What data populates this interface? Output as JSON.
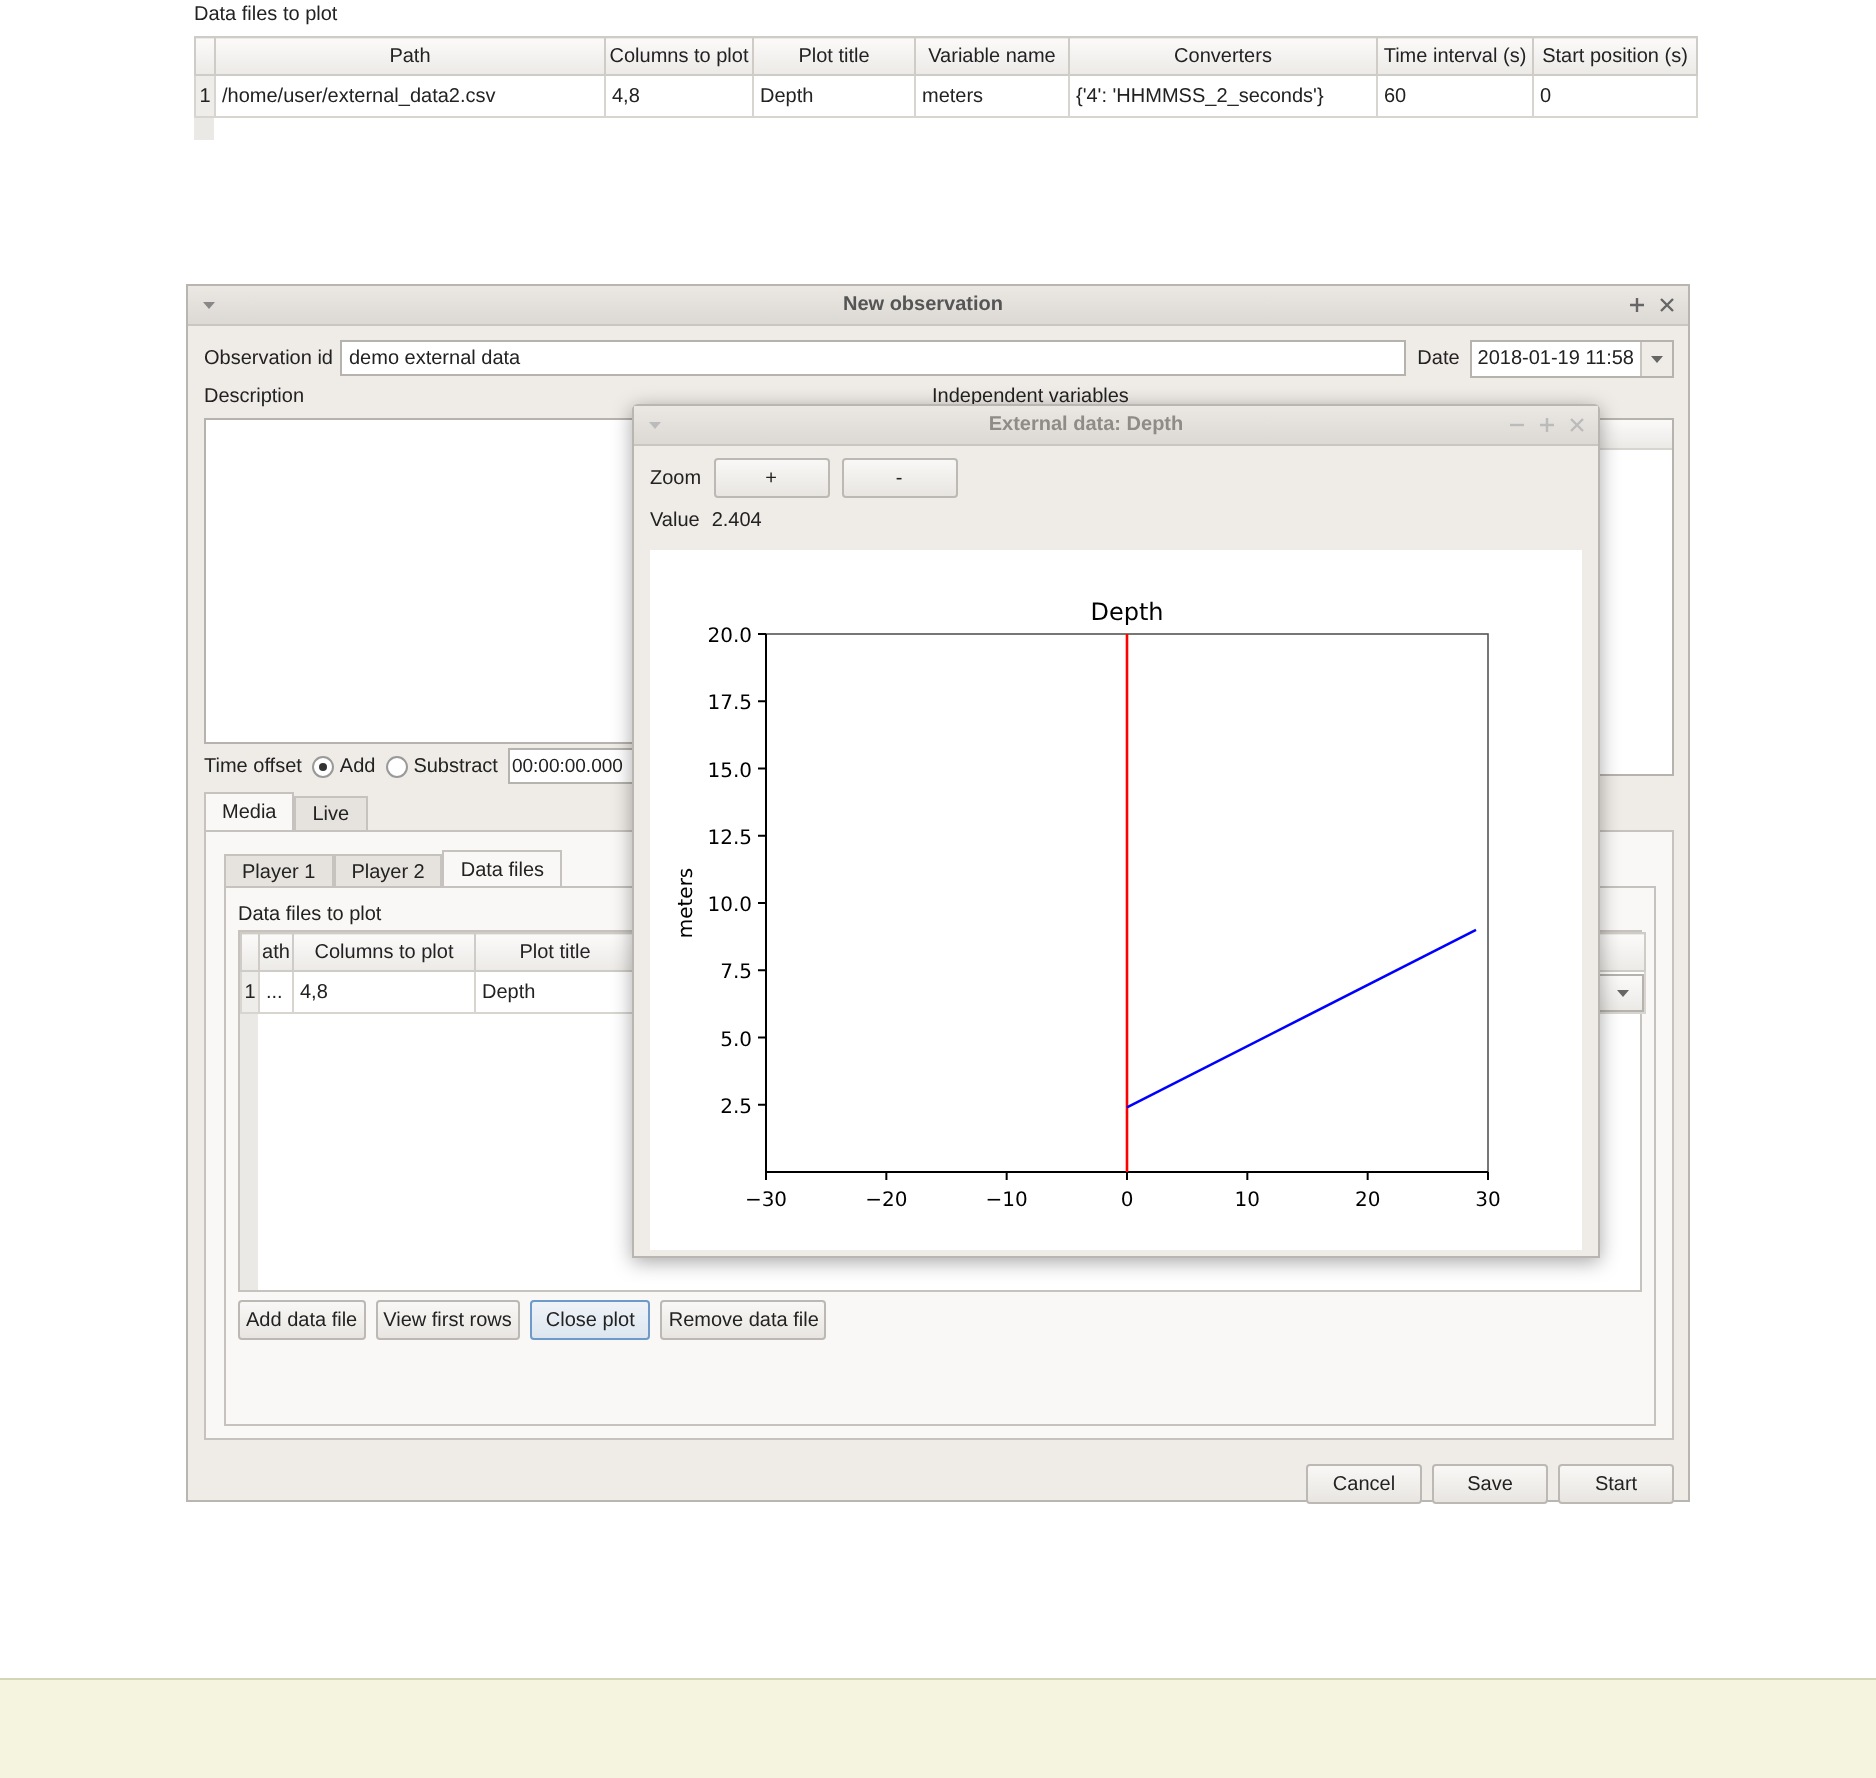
{
  "data_files_panel": {
    "label": "Data files to plot",
    "table": {
      "columns": [
        "Path",
        "Columns to plot",
        "Plot title",
        "Variable name",
        "Converters",
        "Time interval (s)",
        "Start position (s)"
      ],
      "rows": [
        {
          "number": "1",
          "cells": [
            "/home/user/external_data2.csv",
            "4,8",
            "Depth",
            "meters",
            "{'4': 'HHMMSS_2_seconds'}",
            "60",
            "0"
          ]
        }
      ]
    }
  },
  "window": {
    "title": "New observation"
  },
  "observation_id": {
    "label": "Observation id",
    "value": "demo external data"
  },
  "date": {
    "label": "Date",
    "value": "2018-01-19 11:58"
  },
  "description": {
    "label": "Description"
  },
  "independent_variables": {
    "label": "Independent variables"
  },
  "time_offset": {
    "label": "Time offset",
    "options": [
      {
        "label": "Add",
        "selected": true
      },
      {
        "label": "Substract",
        "selected": false
      }
    ],
    "value": "00:00:00.000"
  },
  "tabs": [
    {
      "label": "Media",
      "selected": true
    },
    {
      "label": "Live",
      "selected": false
    }
  ],
  "media_tabs": [
    {
      "label": "Player 1",
      "selected": false
    },
    {
      "label": "Player 2",
      "selected": false
    },
    {
      "label": "Data files",
      "selected": true
    }
  ],
  "data_files": {
    "label": "Data files to plot",
    "table": {
      "columns": [
        "ath",
        "Columns to plot",
        "Plot title"
      ],
      "rows": [
        {
          "number": "1",
          "cells": [
            "...",
            "4,8",
            "Depth"
          ]
        }
      ]
    },
    "buttons": [
      {
        "label": "Add data file",
        "focused": false
      },
      {
        "label": "View first rows",
        "focused": false
      },
      {
        "label": "Close plot",
        "focused": true
      },
      {
        "label": "Remove data file",
        "focused": false
      }
    ]
  },
  "footer_buttons": [
    "Cancel",
    "Save",
    "Start"
  ],
  "plot_window": {
    "title": "External data: Depth",
    "zoom_label": "Zoom",
    "zoom_buttons": [
      "+",
      "-"
    ],
    "value_label": "Value",
    "value": "2.404",
    "chart_data": {
      "type": "line",
      "title": "Depth",
      "ylabel": "meters",
      "x": [
        0,
        29
      ],
      "series": [
        {
          "color": "#0000ff",
          "values": [
            2.4,
            9
          ]
        }
      ],
      "xlim": [
        -30,
        30
      ],
      "ylim": [
        0,
        20
      ],
      "xticks": [
        {
          "value": -30,
          "label": "−30"
        },
        {
          "value": -20,
          "label": "−20"
        },
        {
          "value": -10,
          "label": "−10"
        },
        {
          "value": 0,
          "label": "0"
        },
        {
          "value": 10,
          "label": "10"
        },
        {
          "value": 20,
          "label": "20"
        },
        {
          "value": 30,
          "label": "30"
        }
      ],
      "yticks": [
        {
          "value": 2.5,
          "label": "2.5"
        },
        {
          "value": 5,
          "label": "5.0"
        },
        {
          "value": 7.5,
          "label": "7.5"
        },
        {
          "value": 10,
          "label": "10.0"
        },
        {
          "value": 12.5,
          "label": "12.5"
        },
        {
          "value": 15,
          "label": "15.0"
        },
        {
          "value": 17.5,
          "label": "17.5"
        },
        {
          "value": 20,
          "label": "20.0"
        }
      ],
      "ref_lines": [
        {
          "axis": "x",
          "value": 0,
          "color": "#ff0000"
        }
      ]
    }
  }
}
